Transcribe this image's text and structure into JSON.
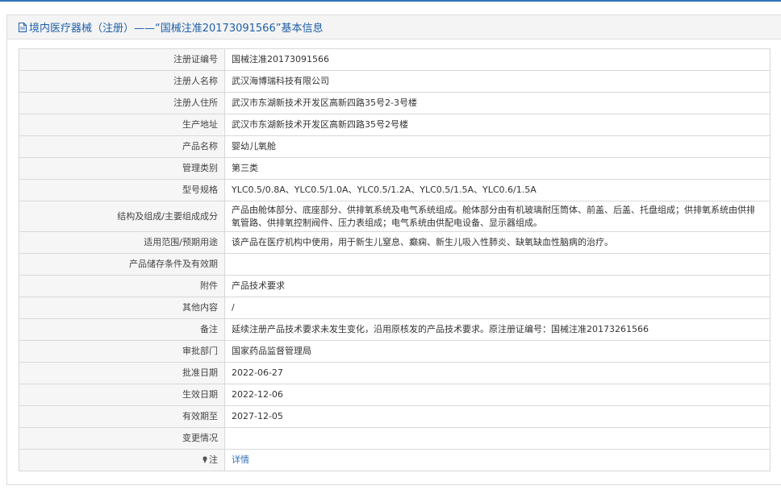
{
  "header": {
    "title": "境内医疗器械（注册）——“国械注准20173091566”基本信息"
  },
  "rows": [
    {
      "label": "注册证编号",
      "value": "国械注准20173091566"
    },
    {
      "label": "注册人名称",
      "value": "武汉海博瑞科技有限公司"
    },
    {
      "label": "注册人住所",
      "value": "武汉市东湖新技术开发区高新四路35号2-3号楼"
    },
    {
      "label": "生产地址",
      "value": "武汉市东湖新技术开发区高新四路35号2号楼"
    },
    {
      "label": "产品名称",
      "value": "婴幼儿氧舱"
    },
    {
      "label": "管理类别",
      "value": "第三类"
    },
    {
      "label": "型号规格",
      "value": "YLC0.5/0.8A、YLC0.5/1.0A、YLC0.5/1.2A、YLC0.5/1.5A、YLC0.6/1.5A"
    },
    {
      "label": "结构及组成/主要组成成分",
      "value": "产品由舱体部分、底座部分、供排氧系统及电气系统组成。舱体部分由有机玻璃耐压筒体、前盖、后盖、托盘组成；供排氧系统由供排氧管路、供排氧控制阀件、压力表组成；电气系统由供配电设备、显示器组成。"
    },
    {
      "label": "适用范围/预期用途",
      "value": "该产品在医疗机构中使用，用于新生儿窒息、癫痫、新生儿吸入性肺炎、缺氧缺血性脑病的治疗。"
    },
    {
      "label": "产品储存条件及有效期",
      "value": ""
    },
    {
      "label": "附件",
      "value": "产品技术要求"
    },
    {
      "label": "其他内容",
      "value": "/"
    },
    {
      "label": "备注",
      "value": "延续注册产品技术要求未发生变化，沿用原核发的产品技术要求。原注册证编号：国械注准20173261566"
    },
    {
      "label": "审批部门",
      "value": "国家药品监督管理局"
    },
    {
      "label": "批准日期",
      "value": "2022-06-27"
    },
    {
      "label": "生效日期",
      "value": "2022-12-06"
    },
    {
      "label": "有效期至",
      "value": "2027-12-05"
    },
    {
      "label": "变更情况",
      "value": ""
    }
  ],
  "note": {
    "label": "注",
    "link_text": "详情",
    "icon": "map-pin-icon"
  },
  "colors": {
    "accent": "#2f73b8",
    "label_bg": "#f6f6f6",
    "border": "#d8d8d8"
  }
}
